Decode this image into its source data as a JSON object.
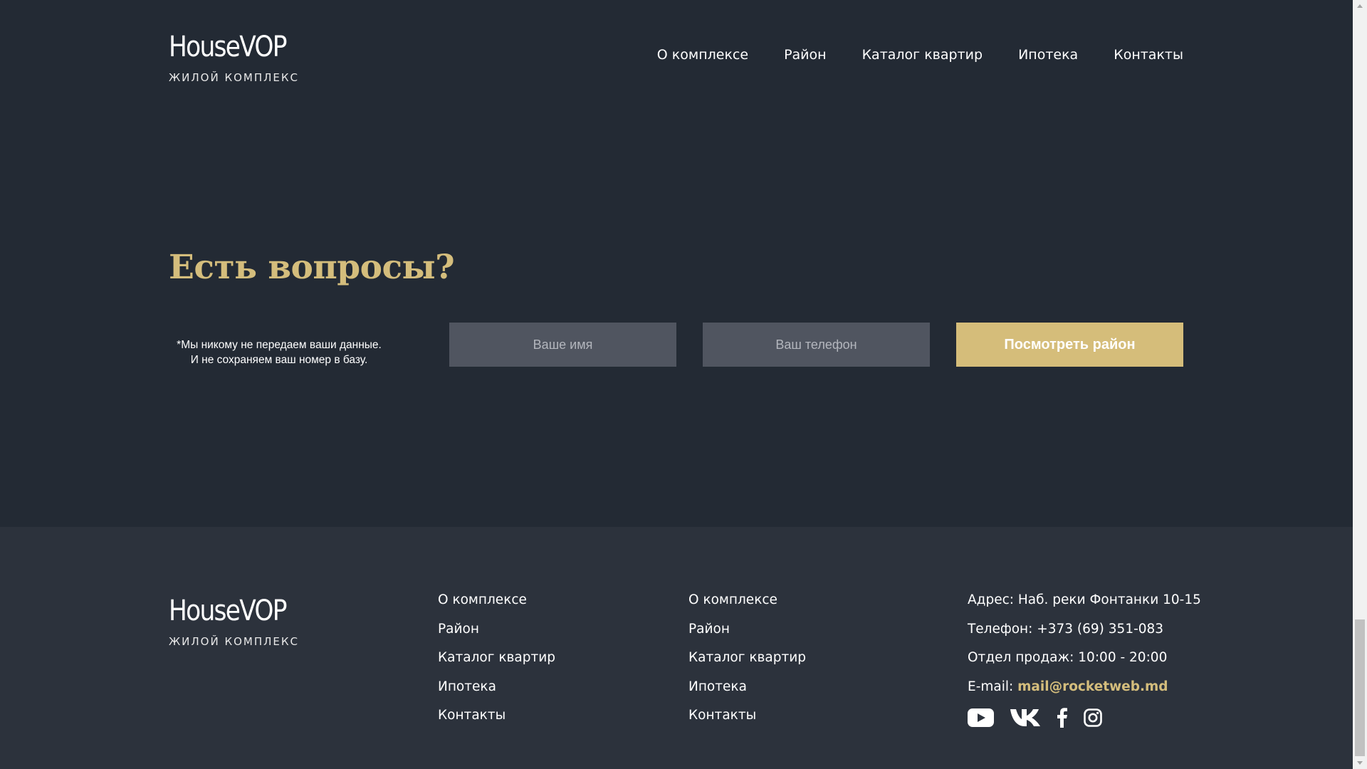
{
  "brand": {
    "name": "HouseVOP",
    "subtitle": "ЖИЛОЙ КОМПЛЕКС"
  },
  "header": {
    "nav": [
      "О комплексе",
      "Район",
      "Каталог квартир",
      "Ипотека",
      "Контакты"
    ]
  },
  "questions": {
    "title": "Есть вопросы?",
    "note_line1": "*Мы никому не передаем ваши данные.",
    "note_line2": "И не сохраняем ваш номер в базу.",
    "name_placeholder": "Ваше имя",
    "phone_placeholder": "Ваш телефон",
    "submit_label": "Посмотреть район"
  },
  "footer": {
    "nav_col1": [
      "О комплексе",
      "Район",
      "Каталог квартир",
      "Ипотека",
      "Контакты"
    ],
    "nav_col2": [
      "О комплексе",
      "Район",
      "Каталог квартир",
      "Ипотека",
      "Контакты"
    ],
    "contacts": {
      "address": "Адрес: Наб. реки Фонтанки 10-15",
      "phone": "Телефон: +373 (69) 351-083",
      "sales": "Отдел продаж: 10:00 - 20:00",
      "email_label": "E-mail: ",
      "email": "mail@rocketweb.md"
    },
    "socials": [
      "youtube-icon",
      "vk-icon",
      "facebook-icon",
      "instagram-icon"
    ]
  },
  "colors": {
    "background": "#232a34",
    "footer_background": "#2c323c",
    "accent": "#d4bd7c",
    "input_background": "#505560"
  }
}
